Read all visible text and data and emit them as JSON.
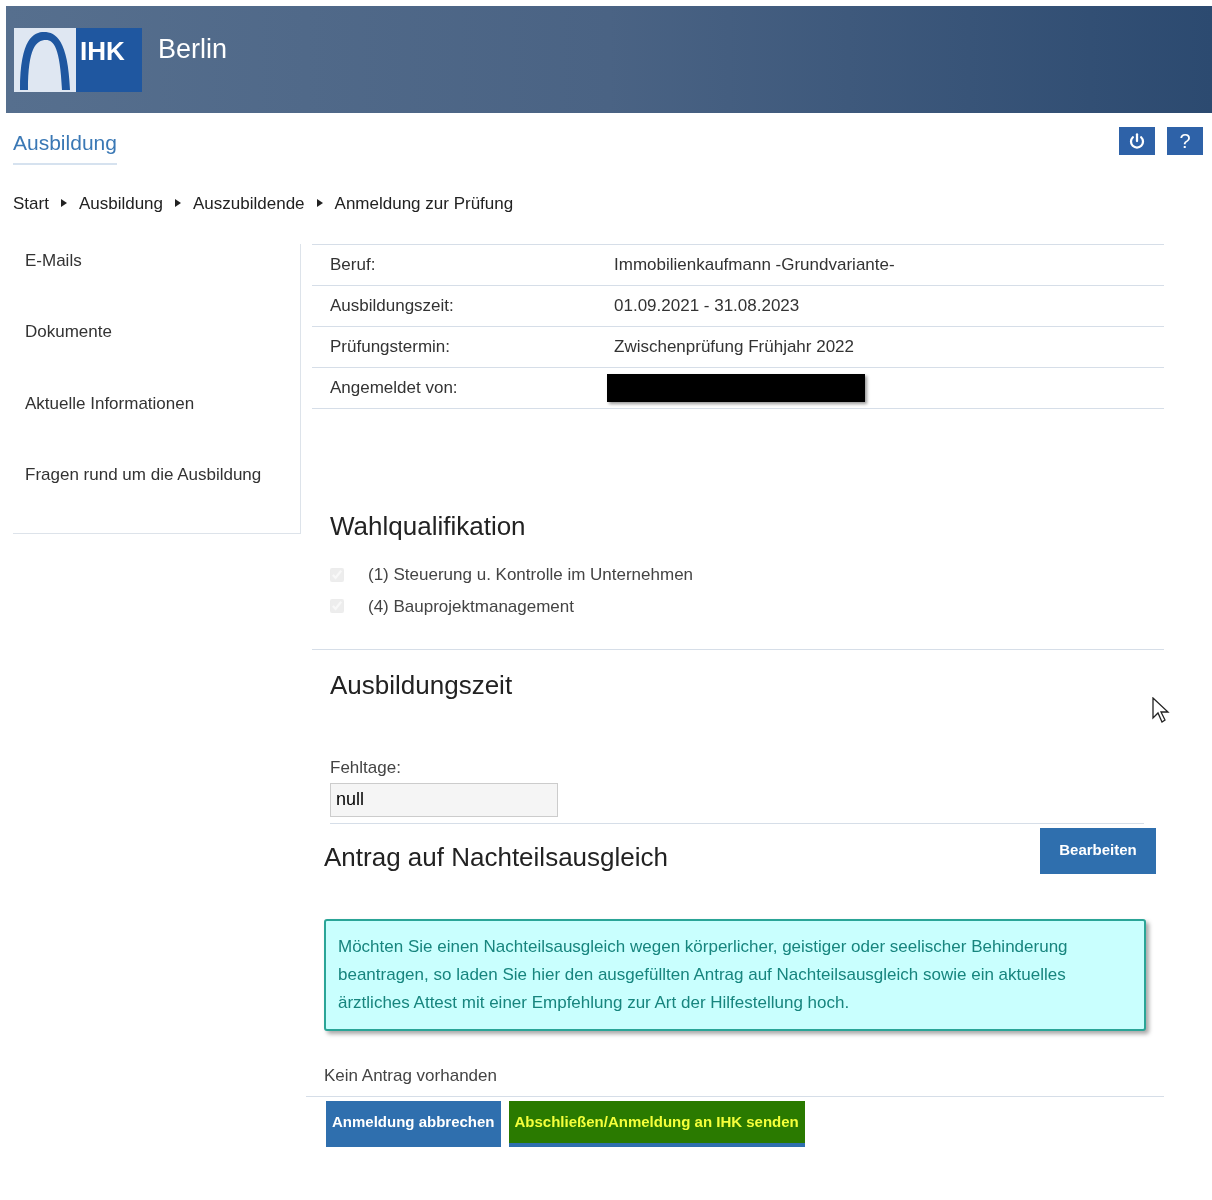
{
  "header": {
    "logo_text": "IHK",
    "city": "Berlin"
  },
  "section_title": "Ausbildung",
  "help_button": "?",
  "breadcrumb": [
    "Start",
    "Ausbildung",
    "Auszubildende",
    "Anmeldung zur Prüfung"
  ],
  "sidebar": {
    "items": [
      {
        "label": "E-Mails"
      },
      {
        "label": "Dokumente"
      },
      {
        "label": "Aktuelle Informationen"
      },
      {
        "label": "Fragen rund um die Ausbildung"
      }
    ]
  },
  "details": [
    {
      "label": "Beruf:",
      "kind": "text",
      "value": "Immobilienkaufmann -Grundvariante-"
    },
    {
      "label": "Ausbildungszeit:",
      "kind": "text",
      "value": "01.09.2021 - 31.08.2023"
    },
    {
      "label": "Prüfungstermin:",
      "kind": "text",
      "value": "Zwischenprüfung Frühjahr 2022"
    },
    {
      "label": "Angemeldet von:",
      "kind": "redacted"
    }
  ],
  "wahlqualifikation": {
    "title": "Wahlqualifikation",
    "options": [
      {
        "label": "(1) Steuerung u. Kontrolle im Unternehmen",
        "checked": true,
        "disabled": true
      },
      {
        "label": "(4) Bauprojektmanagement",
        "checked": true,
        "disabled": true
      }
    ]
  },
  "ausbildungszeit": {
    "title": "Ausbildungszeit",
    "field_label": "Fehltage:",
    "field_value": "null"
  },
  "nachteilsausgleich": {
    "title": "Antrag auf Nachteilsausgleich",
    "edit_button": "Bearbeiten",
    "notice": "Möchten Sie einen Nachteilsausgleich wegen körperlicher, geistiger oder seelischer Behinderung beantragen, so laden Sie hier den ausgefüllten Antrag auf Nachteilsausgleich sowie ein aktuelles ärztliches Attest mit einer Empfehlung zur Art der Hilfestellung hoch.",
    "status": "Kein Antrag vorhanden"
  },
  "actions": [
    {
      "label": "Anmeldung abbrechen",
      "kind": "cancel"
    },
    {
      "label": "Abschließen/Anmeldung an IHK senden",
      "kind": "submit"
    }
  ]
}
